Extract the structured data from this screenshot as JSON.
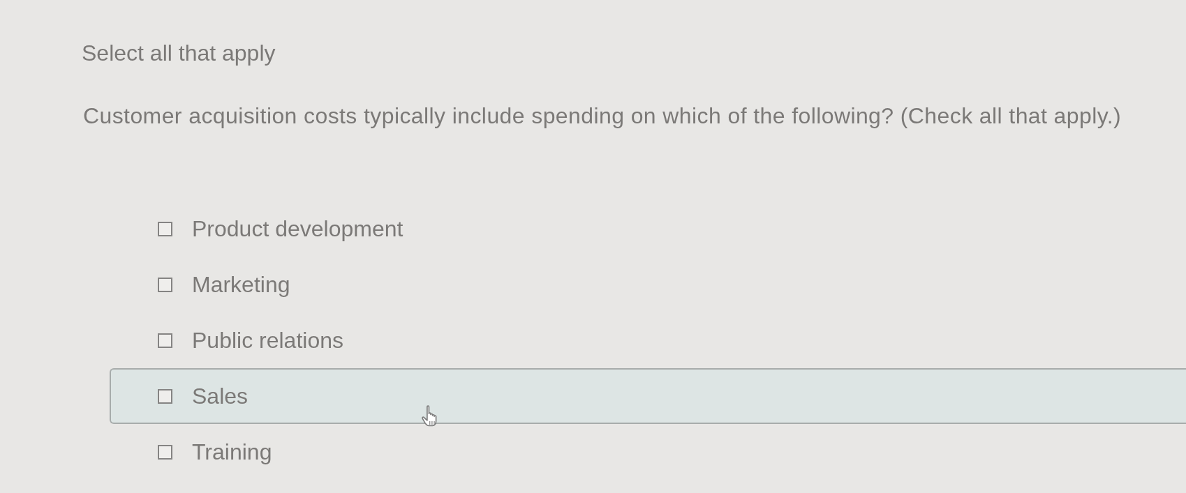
{
  "instruction": "Select all that apply",
  "question": "Customer acquisition costs typically include spending on which of the following? (Check all that apply.)",
  "options": [
    {
      "label": "Product development",
      "checked": false,
      "highlighted": false
    },
    {
      "label": "Marketing",
      "checked": false,
      "highlighted": false
    },
    {
      "label": "Public relations",
      "checked": false,
      "highlighted": false
    },
    {
      "label": "Sales",
      "checked": false,
      "highlighted": true
    },
    {
      "label": "Training",
      "checked": false,
      "highlighted": false
    }
  ]
}
